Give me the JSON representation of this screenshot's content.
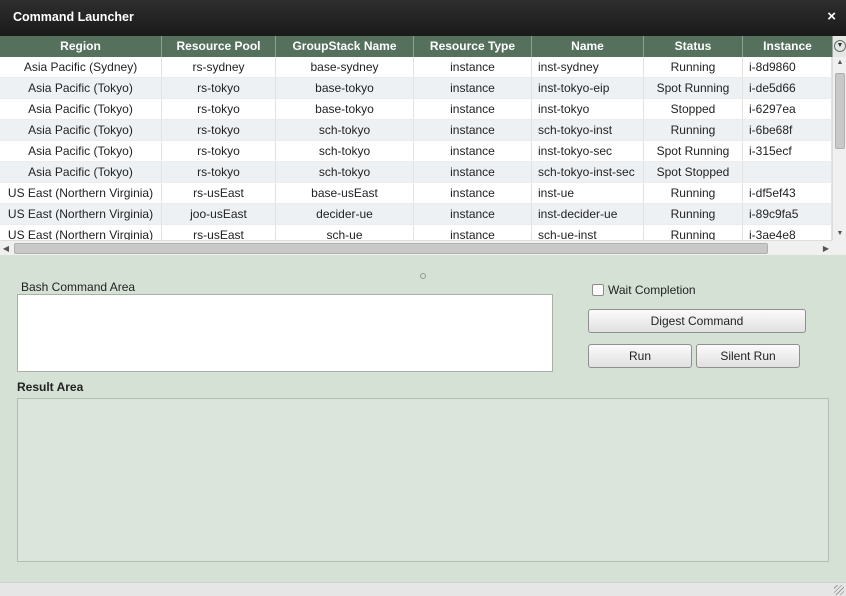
{
  "window": {
    "title": "Command Launcher",
    "close_label": "×"
  },
  "grid": {
    "columns": [
      "Region",
      "Resource Pool",
      "GroupStack Name",
      "Resource Type",
      "Name",
      "Status",
      "Instance"
    ],
    "rows": [
      [
        "Asia Pacific (Sydney)",
        "rs-sydney",
        "base-sydney",
        "instance",
        "inst-sydney",
        "Running",
        "i-8d9860"
      ],
      [
        "Asia Pacific (Tokyo)",
        "rs-tokyo",
        "base-tokyo",
        "instance",
        "inst-tokyo-eip",
        "Spot Running",
        "i-de5d66"
      ],
      [
        "Asia Pacific (Tokyo)",
        "rs-tokyo",
        "base-tokyo",
        "instance",
        "inst-tokyo",
        "Stopped",
        "i-6297ea"
      ],
      [
        "Asia Pacific (Tokyo)",
        "rs-tokyo",
        "sch-tokyo",
        "instance",
        "sch-tokyo-inst",
        "Running",
        "i-6be68f"
      ],
      [
        "Asia Pacific (Tokyo)",
        "rs-tokyo",
        "sch-tokyo",
        "instance",
        "inst-tokyo-sec",
        "Spot Running",
        "i-315ecf"
      ],
      [
        "Asia Pacific (Tokyo)",
        "rs-tokyo",
        "sch-tokyo",
        "instance",
        "sch-tokyo-inst-sec",
        "Spot Stopped",
        ""
      ],
      [
        "US East (Northern Virginia)",
        "rs-usEast",
        "base-usEast",
        "instance",
        "inst-ue",
        "Running",
        "i-df5ef43"
      ],
      [
        "US East (Northern Virginia)",
        "joo-usEast",
        "decider-ue",
        "instance",
        "inst-decider-ue",
        "Running",
        "i-89c9fa5"
      ],
      [
        "US East (Northern Virginia)",
        "rs-usEast",
        "sch-ue",
        "instance",
        "sch-ue-inst",
        "Running",
        "i-3ae4e8"
      ]
    ]
  },
  "bash": {
    "label": "Bash Command Area",
    "value": ""
  },
  "result": {
    "label": "Result Area"
  },
  "controls": {
    "wait_label": "Wait Completion",
    "wait_checked": false,
    "digest_label": "Digest Command",
    "run_label": "Run",
    "silent_run_label": "Silent Run"
  },
  "icons": {
    "menu": "column-menu-icon",
    "scroll_up": "scroll-up-icon",
    "scroll_down": "scroll-down-icon",
    "scroll_left": "scroll-left-icon",
    "scroll_right": "scroll-right-icon",
    "grip": "resize-grip-icon"
  }
}
